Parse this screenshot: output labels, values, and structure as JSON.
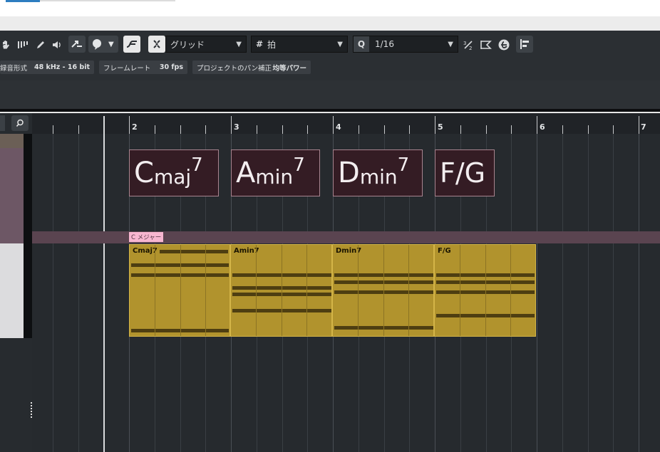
{
  "toolbar": {
    "snap_type": "グリッド",
    "grid_mode": "拍",
    "quantize_value": "1/16",
    "snap_icon": "hash-icon",
    "quantize_icon": "q-icon"
  },
  "info_bar": {
    "record_format_label": "録音形式",
    "record_format_value": "48 kHz - 16 bit",
    "frame_rate_label": "フレームレート",
    "frame_rate_value": "30 fps",
    "pan_label": "プロジェクトのパン補正",
    "pan_value": "均等パワー"
  },
  "ruler": {
    "bars": [
      "2",
      "3",
      "4",
      "5",
      "6",
      "7"
    ]
  },
  "chord_track": {
    "chords": [
      {
        "root": "C",
        "quality": "maj",
        "ext": "7"
      },
      {
        "root": "A",
        "quality": "min",
        "ext": "7"
      },
      {
        "root": "D",
        "quality": "min",
        "ext": "7"
      },
      {
        "root": "F/G",
        "quality": "",
        "ext": ""
      }
    ]
  },
  "scale_track": {
    "scale_label": "C メジャー"
  },
  "midi_events": [
    {
      "name": "Cmaj7"
    },
    {
      "name": "Amin7"
    },
    {
      "name": "Dmin7"
    },
    {
      "name": "F/G"
    }
  ],
  "colors": {
    "event_fill": "#b1932d",
    "chord_fill": "#341c24",
    "scale_tag": "#f7b6d0"
  }
}
